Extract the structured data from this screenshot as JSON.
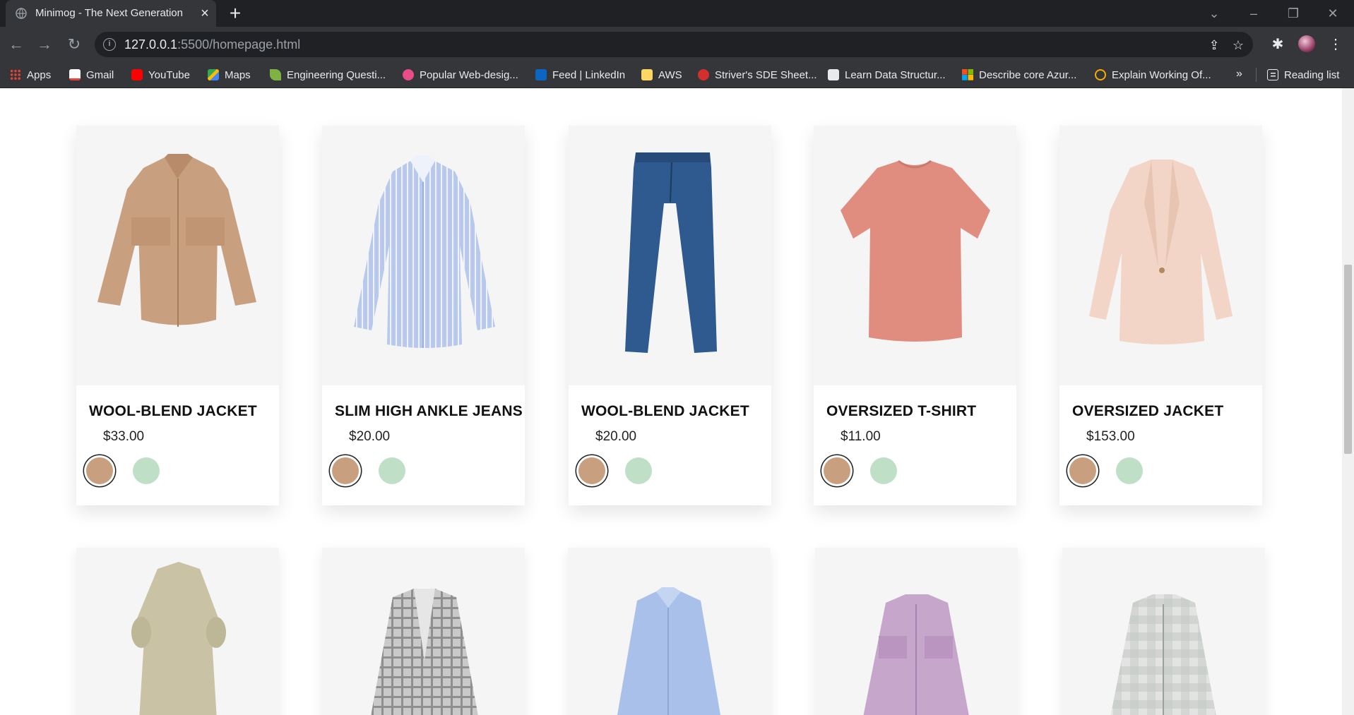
{
  "browser": {
    "tab_title": "Minimog - The Next Generation",
    "url_host": "127.0.0.1",
    "url_path": ":5500/homepage.html",
    "bookmarks": [
      "Apps",
      "Gmail",
      "YouTube",
      "Maps",
      "Engineering Questi...",
      "Popular Web-desig...",
      "Feed | LinkedIn",
      "AWS",
      "Striver's SDE Sheet...",
      "Learn Data Structur...",
      "Describe core Azur...",
      "Explain Working Of..."
    ],
    "more_bookmarks": "»",
    "reading_list": "Reading list"
  },
  "products": [
    {
      "name": "WOOL-BLEND JACKET",
      "price": "$33.00",
      "image": "beige-jacket"
    },
    {
      "name": "SLIM HIGH ANKLE JEANS",
      "price": "$20.00",
      "image": "striped-shirt"
    },
    {
      "name": "WOOL-BLEND JACKET",
      "price": "$20.00",
      "image": "blue-jeans"
    },
    {
      "name": "OVERSIZED T-SHIRT",
      "price": "$11.00",
      "image": "coral-tshirt"
    },
    {
      "name": "OVERSIZED JACKET",
      "price": "$153.00",
      "image": "pink-blazer"
    }
  ],
  "products_row2": [
    "khaki-dress",
    "plaid-blazer",
    "blue-shirt",
    "lilac-shirt-jacket",
    "checked-shirt"
  ],
  "swatch_colors": {
    "primary": "#c9a07f",
    "secondary": "#bfe0c7"
  }
}
